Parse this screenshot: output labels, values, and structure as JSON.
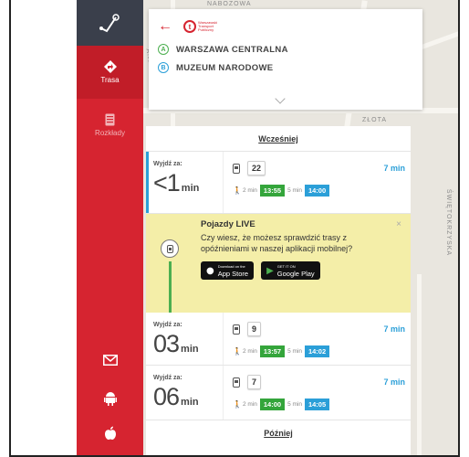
{
  "sidebar": {
    "items": [
      {
        "label": "Trasa",
        "icon": "route-pin-icon"
      },
      {
        "label": "Rozkłady",
        "icon": "timetable-icon"
      }
    ],
    "bottom_icons": [
      "mail-icon",
      "android-icon",
      "apple-icon"
    ]
  },
  "map": {
    "street_labels": [
      "NABOZOWA",
      "ANDERSA",
      "ZŁOTA",
      "ŚWIĘTOKRZYSKA"
    ]
  },
  "route": {
    "from": {
      "badge": "A",
      "name": "WARSZAWA CENTRALNA"
    },
    "to": {
      "badge": "B",
      "name": "MUZEUM NARODOWE"
    }
  },
  "results": {
    "earlier_label": "Wcześniej",
    "later_label": "Później",
    "trips": [
      {
        "leave_label": "Wyjdź za:",
        "leave_value": "<1",
        "leave_unit": "min",
        "line": "22",
        "duration": "7 min",
        "walk_before": "2 min",
        "depart": "13:55",
        "ride": "5 min",
        "arrive": "14:00"
      },
      {
        "leave_label": "Wyjdź za:",
        "leave_value": "03",
        "leave_unit": "min",
        "line": "9",
        "duration": "7 min",
        "walk_before": "2 min",
        "depart": "13:57",
        "ride": "5 min",
        "arrive": "14:02"
      },
      {
        "leave_label": "Wyjdź za:",
        "leave_value": "06",
        "leave_unit": "min",
        "line": "7",
        "duration": "7 min",
        "walk_before": "2 min",
        "depart": "14:00",
        "ride": "5 min",
        "arrive": "14:05"
      }
    ],
    "live_banner": {
      "title": "Pojazdy LIVE",
      "text": "Czy wiesz, że możesz sprawdzić trasy z opóźnieniami w naszej aplikacji mobilnej?",
      "close": "×",
      "app_store_small": "Download on the",
      "app_store": "App Store",
      "google_play_small": "GET IT ON",
      "google_play": "Google Play"
    }
  },
  "colors": {
    "brand_red": "#d62430",
    "sidebar_dark": "#3a3f4b",
    "accent_blue": "#2b9fd8",
    "depart_green": "#34a53b"
  }
}
